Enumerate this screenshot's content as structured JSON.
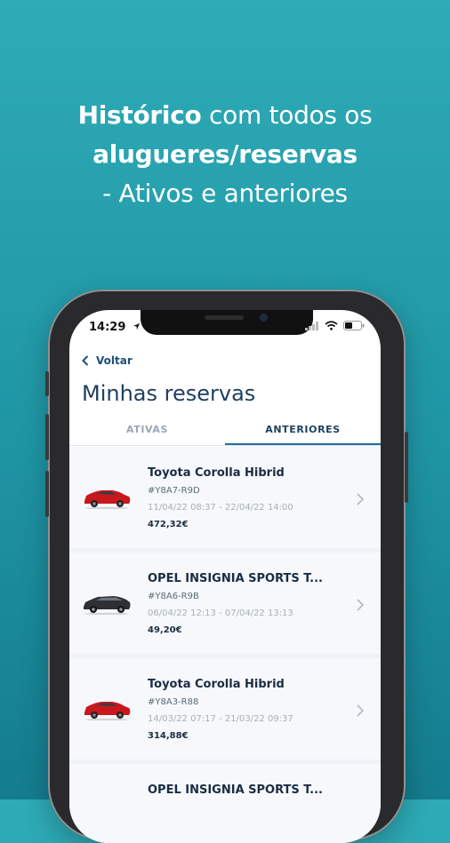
{
  "headline": {
    "part1_bold": "Histórico",
    "part1_rest": " com todos os",
    "line2_bold": "alugueres/reservas",
    "line3": "- Ativos e anteriores"
  },
  "status_bar": {
    "time": "14:29"
  },
  "nav": {
    "back_label": "Voltar"
  },
  "page": {
    "title": "Minhas reservas"
  },
  "tabs": [
    {
      "label": "ATIVAS",
      "active": false
    },
    {
      "label": "ANTERIORES",
      "active": true
    }
  ],
  "reservations": [
    {
      "model": "Toyota Corolla Hibrid",
      "code": "#Y8A7-R9D",
      "dates": "11/04/22 08:37 - 22/04/22 14:00",
      "price": "472,32€",
      "car_color": "#c8181e"
    },
    {
      "model": "OPEL INSIGNIA SPORTS T...",
      "code": "#Y8A6-R9B",
      "dates": "06/04/22 12:13 - 07/04/22 13:13",
      "price": "49,20€",
      "car_color": "#2d3035"
    },
    {
      "model": "Toyota Corolla Hibrid",
      "code": "#Y8A3-R88",
      "dates": "14/03/22 07:17 - 21/03/22 09:37",
      "price": "314,88€",
      "car_color": "#c8181e"
    },
    {
      "model": "OPEL INSIGNIA SPORTS T..."
    }
  ],
  "colors": {
    "background_top": "#2eabb6",
    "background_bottom": "#147c8e",
    "accent": "#1f6f9a",
    "title": "#1f3f5e"
  }
}
